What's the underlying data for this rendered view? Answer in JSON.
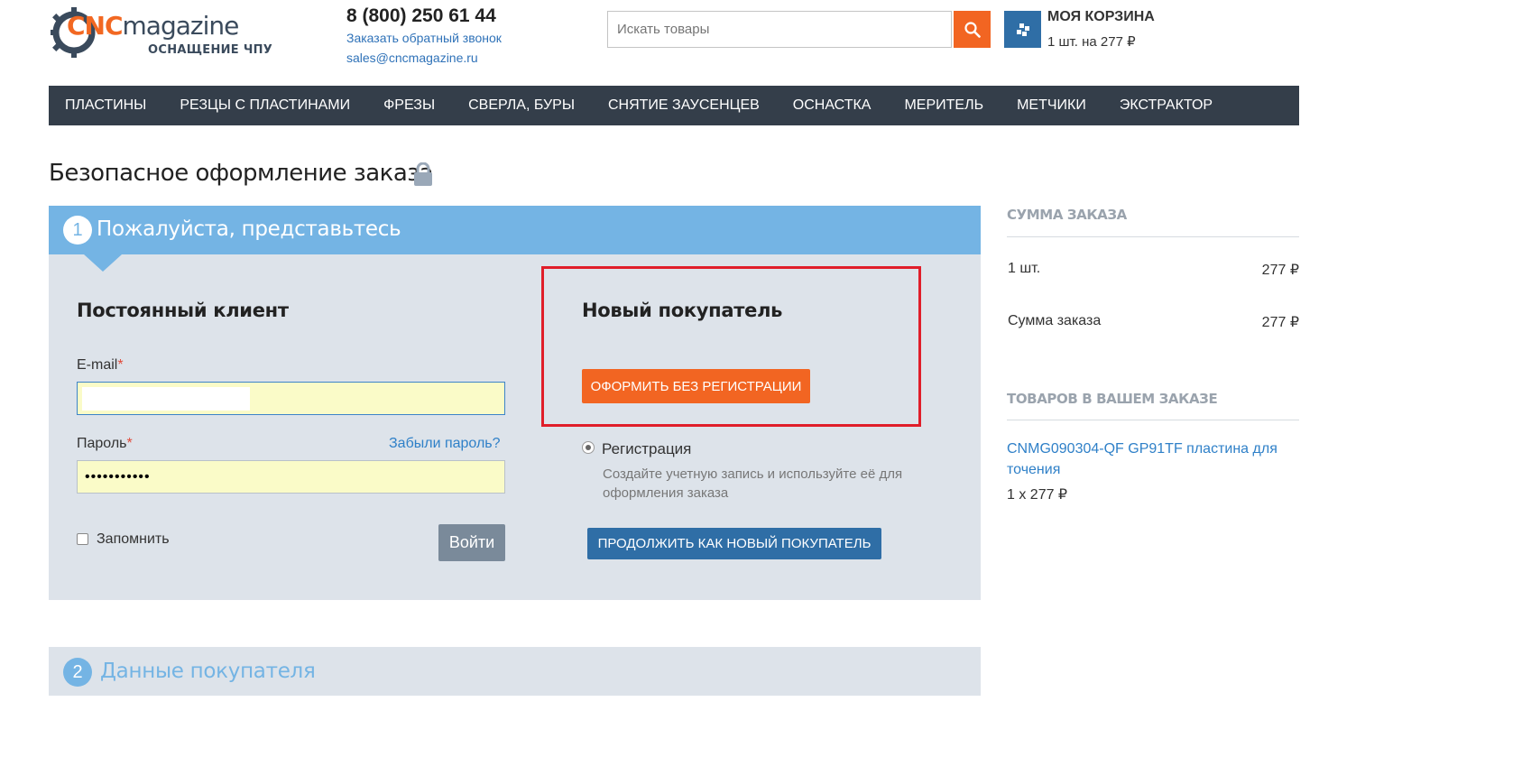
{
  "header": {
    "logo": {
      "brand_cnc": "CNC",
      "brand_magazine": "magazine",
      "tagline": "ОСНАЩЕНИЕ ЧПУ"
    },
    "phone": "8 (800) 250 61 44",
    "callback_link": "Заказать обратный звонок",
    "email_link": "sales@cncmagazine.ru",
    "search": {
      "placeholder": "Искать товары",
      "button_icon": "search-icon"
    },
    "cart": {
      "title": "МОЯ КОРЗИНА",
      "summary": "1 шт. на 277 ₽",
      "icon": "cart-icon"
    }
  },
  "nav": {
    "items": [
      {
        "label": "ПЛАСТИНЫ"
      },
      {
        "label": "РЕЗЦЫ С ПЛАСТИНАМИ"
      },
      {
        "label": "ФРЕЗЫ"
      },
      {
        "label": "СВЕРЛА, БУРЫ"
      },
      {
        "label": "СНЯТИЕ ЗАУСЕНЦЕВ"
      },
      {
        "label": "ОСНАСТКА"
      },
      {
        "label": "МЕРИТЕЛЬ"
      },
      {
        "label": "МЕТЧИКИ"
      },
      {
        "label": "ЭКСТРАКТОР"
      }
    ]
  },
  "page": {
    "title": "Безопасное оформление заказа",
    "title_icon": "lock-icon"
  },
  "step1": {
    "number": "1",
    "title": "Пожалуйста, представьтесь",
    "returning": {
      "title": "Постоянный клиент",
      "email_label": "E-mail",
      "required_mark": "*",
      "email_value": "",
      "password_label": "Пароль",
      "password_value": "•••••••••••",
      "forgot_link": "Забыли пароль?",
      "remember_label": "Запомнить",
      "remember_checked": false,
      "login_button": "Войти"
    },
    "new_customer": {
      "title": "Новый покупатель",
      "guest_button": "ОФОРМИТЬ БЕЗ РЕГИСТРАЦИИ",
      "register_option": "Регистрация",
      "register_selected": true,
      "register_description": "Создайте учетную запись и используйте её для оформления заказа",
      "continue_button": "ПРОДОЛЖИТЬ КАК НОВЫЙ ПОКУПАТЕЛЬ"
    }
  },
  "step2": {
    "number": "2",
    "title": "Данные покупателя"
  },
  "sidebar": {
    "order_sum_heading": "СУММА ЗАКАЗА",
    "rows": [
      {
        "label": "1 шт.",
        "value": "277 ₽"
      },
      {
        "label": "Сумма заказа",
        "value": "277 ₽"
      }
    ],
    "items_heading": "ТОВАРОВ В ВАШЕМ ЗАКАЗЕ",
    "product": {
      "name": "CNMG090304-QF GP91TF пластина для точения",
      "qty_price": "1 x 277 ₽"
    }
  },
  "colors": {
    "accent_orange": "#f26522",
    "nav_bg": "#343e4a",
    "step_header": "#74b4e4",
    "panel_bg": "#dde3ea",
    "primary_blue": "#2f6ea6",
    "highlight_red": "#e01e2a",
    "link_blue": "#2f80c8"
  }
}
